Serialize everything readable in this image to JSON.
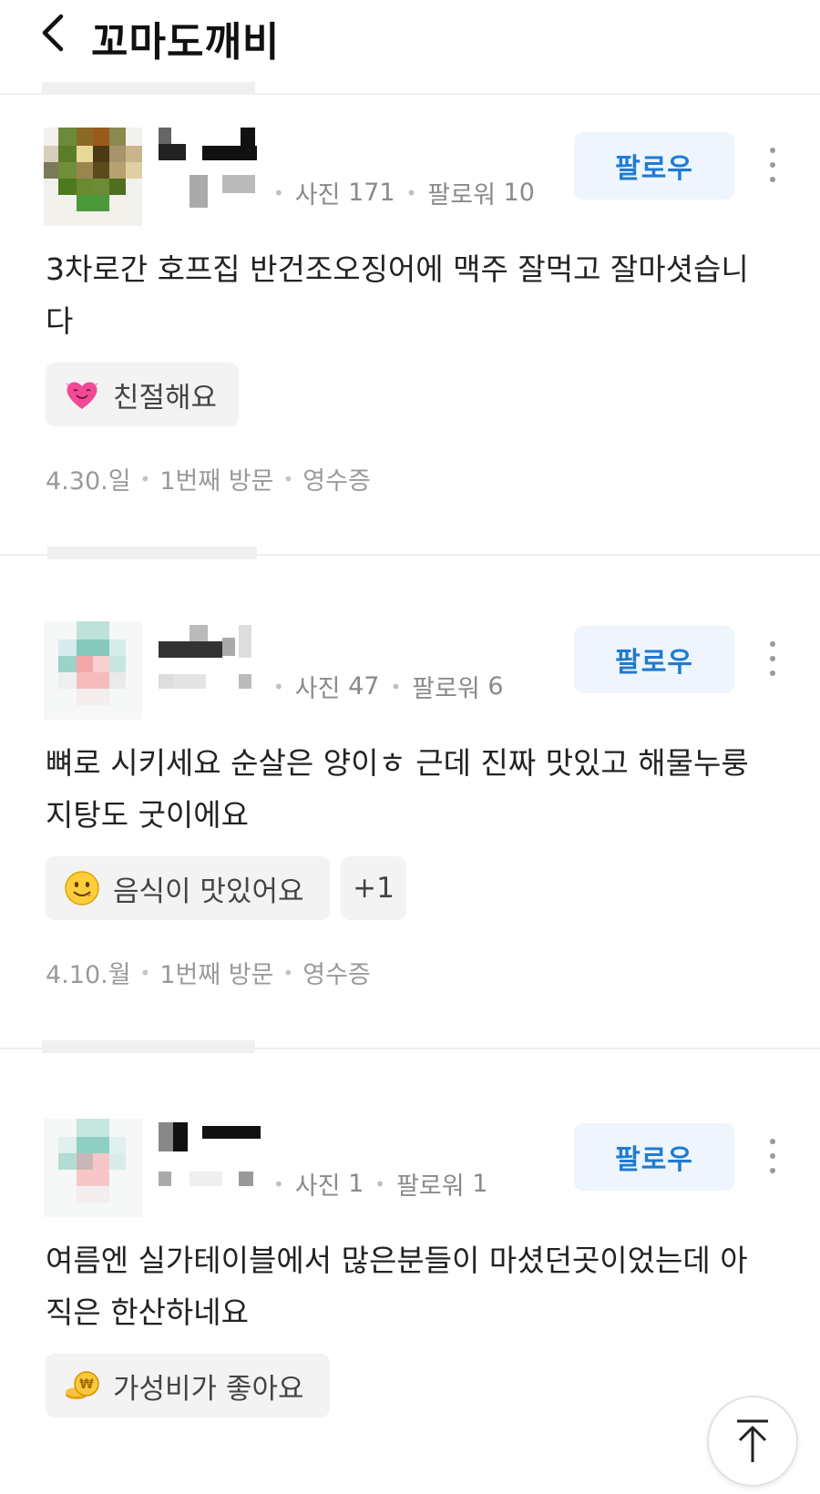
{
  "header": {
    "back_icon": "chevron-left-icon",
    "title": "꼬마도깨비"
  },
  "reviews": [
    {
      "stats": {
        "photos_label": "사진",
        "photos": "171",
        "followers_label": "팔로워",
        "followers": "10"
      },
      "follow_label": "팔로우",
      "more_icon": "more-vertical-icon",
      "text": "3차로간 호프집 반건조오징어에 맥주 잘먹고 잘마셧습니다",
      "tags": [
        {
          "icon": "heart-smile-icon",
          "label": "친절해요"
        }
      ],
      "meta": {
        "date": "4.30.일",
        "visit": "1번째 방문",
        "verify": "영수증"
      }
    },
    {
      "stats": {
        "photos_label": "사진",
        "photos": "47",
        "followers_label": "팔로워",
        "followers": "6"
      },
      "follow_label": "팔로우",
      "more_icon": "more-vertical-icon",
      "text": "뼈로 시키세요 순살은 양이ㅎ 근데 진짜 맛있고 해물누룽지탕도 굿이에요",
      "tags": [
        {
          "icon": "yum-face-icon",
          "label": "음식이 맛있어요"
        }
      ],
      "extra_tags": "+1",
      "meta": {
        "date": "4.10.월",
        "visit": "1번째 방문",
        "verify": "영수증"
      }
    },
    {
      "stats": {
        "photos_label": "사진",
        "photos": "1",
        "followers_label": "팔로워",
        "followers": "1"
      },
      "follow_label": "팔로우",
      "more_icon": "more-vertical-icon",
      "text": "여름엔 실가테이블에서 많은분들이 마셨던곳이었는데 아직은 한산하네요",
      "tags": [
        {
          "icon": "coin-icon",
          "label": "가성비가 좋아요"
        }
      ]
    }
  ],
  "scroll_top_icon": "arrow-up-icon",
  "colors": {
    "follow_text": "#1f7bd1",
    "follow_bg": "#eef5fc",
    "tag_bg": "#f3f3f3",
    "meta": "#9a9a9a"
  }
}
